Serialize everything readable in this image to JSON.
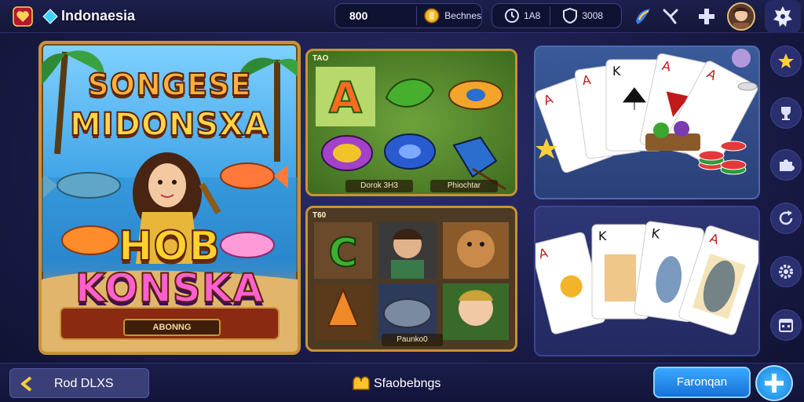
{
  "header": {
    "app_title": "Indonaesia",
    "balance": "800",
    "bonus_label": "Bechnes",
    "stat_1": "1A8",
    "stat_2": "3008"
  },
  "featured": {
    "title_line1": "SONGESE",
    "title_line2": "MIDONSXA",
    "title_line3": "HOB",
    "title_line4": "KONSKA",
    "badge": "ABONNG"
  },
  "tiles": [
    {
      "tag": "TAO",
      "captions": [
        "Dorok 3H3",
        "Phiochtar"
      ]
    },
    {
      "tag": "T60",
      "captions": [
        "Paunko0"
      ]
    }
  ],
  "footer": {
    "back_label": "Rod DLXS",
    "center_label": "Sfaobebngs",
    "primary_label": "Faronqan"
  },
  "icons": {
    "top": [
      "heart-icon",
      "diamond-icon",
      "coin-icon",
      "clock-icon",
      "shield-icon",
      "bolt-icon",
      "sparkle-icon",
      "plus-cross-icon",
      "avatar",
      "gear-menu-icon"
    ],
    "rail": [
      "star-icon",
      "trophy-icon",
      "puzzle-icon",
      "refresh-icon",
      "settings-icon",
      "calendar-icon"
    ]
  },
  "colors": {
    "accent_gold": "#c89236",
    "primary_blue": "#1f8cf0",
    "bg_navy": "#1a1c48"
  }
}
